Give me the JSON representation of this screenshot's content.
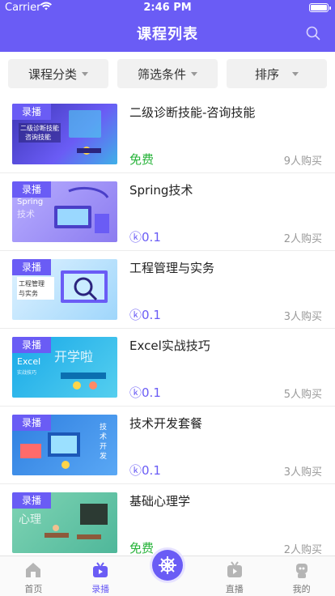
{
  "status_bar": {
    "carrier": "Carrier",
    "time": "2:46 PM"
  },
  "header": {
    "title": "课程列表",
    "search_icon": "search-icon"
  },
  "filters": [
    {
      "label": "课程分类"
    },
    {
      "label": "筛选条件"
    },
    {
      "label": "排序"
    }
  ],
  "courses": [
    {
      "badge": "录播",
      "name": "二级诊断技能-咨询技能",
      "price": "免费",
      "price_type": "free",
      "buyers": "9人购买",
      "thumb_text": "二级诊断技能\n咨询技能",
      "thumb_color": "#5a4fd8"
    },
    {
      "badge": "录播",
      "name": "Spring技术",
      "price": "0.1",
      "price_type": "paid",
      "buyers": "2人购买",
      "thumb_text": "Spring\n技术",
      "thumb_color": "#8c7cf0"
    },
    {
      "badge": "录播",
      "name": "工程管理与实务",
      "price": "0.1",
      "price_type": "paid",
      "buyers": "3人购买",
      "thumb_text": "工程管理\n与实务",
      "thumb_color": "#5fb8f2"
    },
    {
      "badge": "录播",
      "name": "Excel实战技巧",
      "price": "0.1",
      "price_type": "paid",
      "buyers": "5人购买",
      "thumb_text": "Excel\n实战技巧",
      "thumb_color": "#2fb4e8"
    },
    {
      "badge": "录播",
      "name": "技术开发套餐",
      "price": "0.1",
      "price_type": "paid",
      "buyers": "3人购买",
      "thumb_text": "技术\n开发\n套餐",
      "thumb_color": "#3f8de8"
    },
    {
      "badge": "录播",
      "name": "基础心理学",
      "price": "免费",
      "price_type": "free",
      "buyers": "2人购买",
      "thumb_text": "心理",
      "thumb_color": "#68c9a8"
    }
  ],
  "tabbar": [
    {
      "label": "首页",
      "icon": "home-icon",
      "active": false
    },
    {
      "label": "录播",
      "icon": "video-icon",
      "active": true
    },
    {
      "label": "",
      "icon": "helm-icon",
      "active": false
    },
    {
      "label": "直播",
      "icon": "live-tv-icon",
      "active": false
    },
    {
      "label": "我的",
      "icon": "robot-icon",
      "active": false
    }
  ],
  "colors": {
    "accent": "#6a5cf5",
    "free": "#27b33a",
    "muted": "#999999"
  }
}
